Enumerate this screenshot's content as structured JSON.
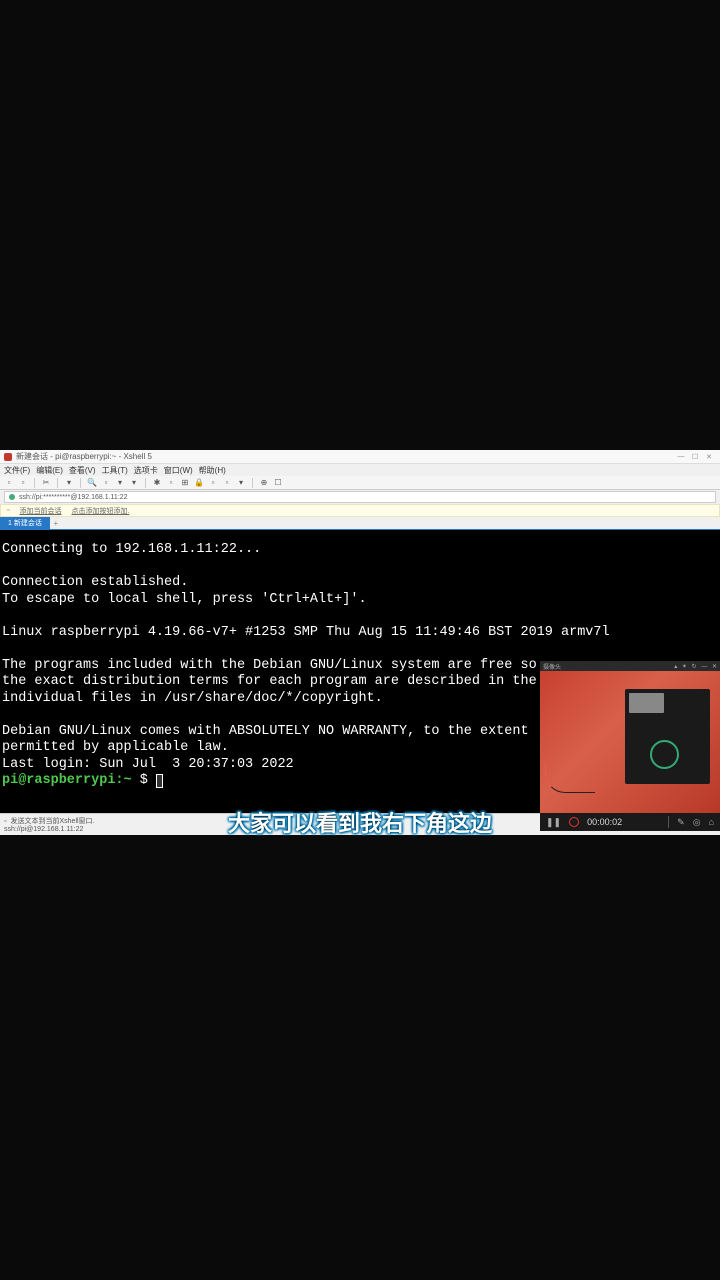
{
  "window": {
    "title": "新建会话 - pi@raspberrypi:~ - Xshell 5"
  },
  "menubar": {
    "items": [
      "文件(F)",
      "编辑(E)",
      "查看(V)",
      "工具(T)",
      "选项卡",
      "窗口(W)",
      "帮助(H)"
    ]
  },
  "addressbar": {
    "text": "ssh://pi:**********@192.168.1.11:22"
  },
  "infobar": {
    "link1": "添加当前会话",
    "link2": "点击添加按钮添加."
  },
  "tab": {
    "label": "1 新建会话"
  },
  "terminal": {
    "lines": [
      "Connecting to 192.168.1.11:22...",
      "",
      "Connection established.",
      "To escape to local shell, press 'Ctrl+Alt+]'.",
      "",
      "Linux raspberrypi 4.19.66-v7+ #1253 SMP Thu Aug 15 11:49:46 BST 2019 armv7l",
      "",
      "The programs included with the Debian GNU/Linux system are free so",
      "the exact distribution terms for each program are described in the",
      "individual files in /usr/share/doc/*/copyright.",
      "",
      "Debian GNU/Linux comes with ABSOLUTELY NO WARRANTY, to the extent",
      "permitted by applicable law.",
      "Last login: Sun Jul  3 20:37:03 2022"
    ],
    "prompt_user": "pi@raspberrypi",
    "prompt_path": ":~",
    "prompt_symbol": " $ "
  },
  "statusbar": {
    "line1": "发送文本到当前Xshell窗口.",
    "line2": "ssh://pi@192.168.1.11:22"
  },
  "camera": {
    "title": "摄像头",
    "time": "00:00:02"
  },
  "subtitle": "大家可以看到我右下角这边"
}
